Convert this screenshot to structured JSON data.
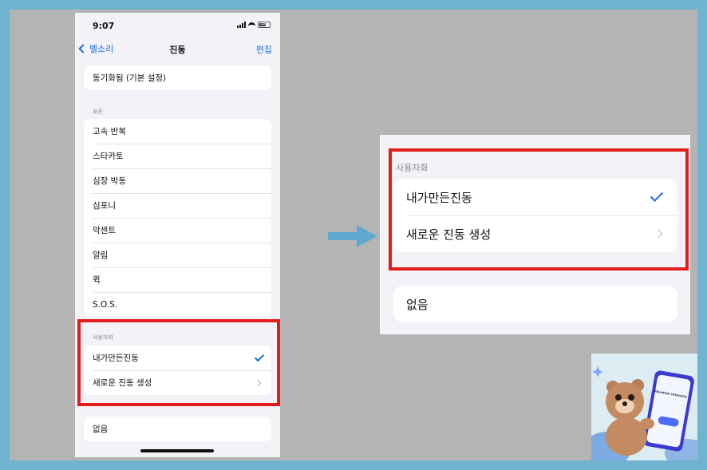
{
  "status_bar": {
    "time": "9:07",
    "battery": "40"
  },
  "nav": {
    "back_label": "벨소리",
    "title": "진동",
    "edit_label": "편집"
  },
  "sync_item": {
    "label": "동기화됨 (기본 설정)"
  },
  "standard_section": {
    "header": "표준",
    "items": [
      "고속 반복",
      "스타카토",
      "심장 박동",
      "심포니",
      "악센트",
      "알림",
      "퀵",
      "S.O.S."
    ]
  },
  "custom_section": {
    "header": "사용자화",
    "items": [
      {
        "label": "내가만든진동",
        "selected": true
      },
      {
        "label": "새로운 진동 생성",
        "disclosure": true
      }
    ]
  },
  "none_item": {
    "label": "없음"
  },
  "colors": {
    "accent": "#1a6ed8",
    "highlight_box": "#e21b1b",
    "arrow": "#5fa9cf",
    "frame": "#6fb3cf"
  },
  "thumbnail": {
    "description_icon": "bear-with-phone-illustration",
    "phone_caption": "Vibration Intensity",
    "button_caption": "Google"
  }
}
